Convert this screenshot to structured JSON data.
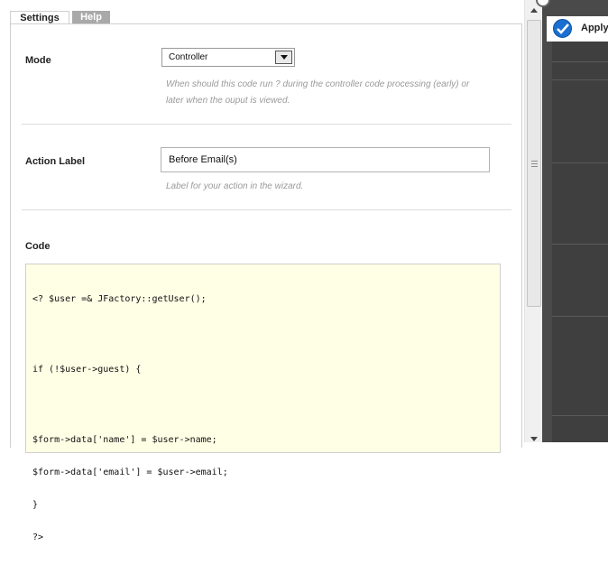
{
  "tabs": [
    {
      "label": "Settings",
      "active": true
    },
    {
      "label": "Help",
      "active": false
    }
  ],
  "mode": {
    "label": "Mode",
    "selected": "Controller",
    "hint_line1": "When should this code run ? during the controller code processing (early) or",
    "hint_line2": "later when the ouput is viewed."
  },
  "action_label": {
    "label": "Action Label",
    "value": "Before Email(s)",
    "hint": "Label for your action in the wizard."
  },
  "code": {
    "label": "Code",
    "lines": [
      "<? $user =& JFactory::getUser();",
      "if (!$user->guest) {",
      "$form->data['name'] = $user->name;",
      "$form->data['email'] = $user->email;",
      "}",
      "?>"
    ]
  },
  "toolbar": {
    "apply_label": "Apply"
  },
  "colors": {
    "code_bg": "#ffffe6",
    "apply_icon": "#1a6fd1",
    "dark_panel": "#4a4a4a"
  }
}
